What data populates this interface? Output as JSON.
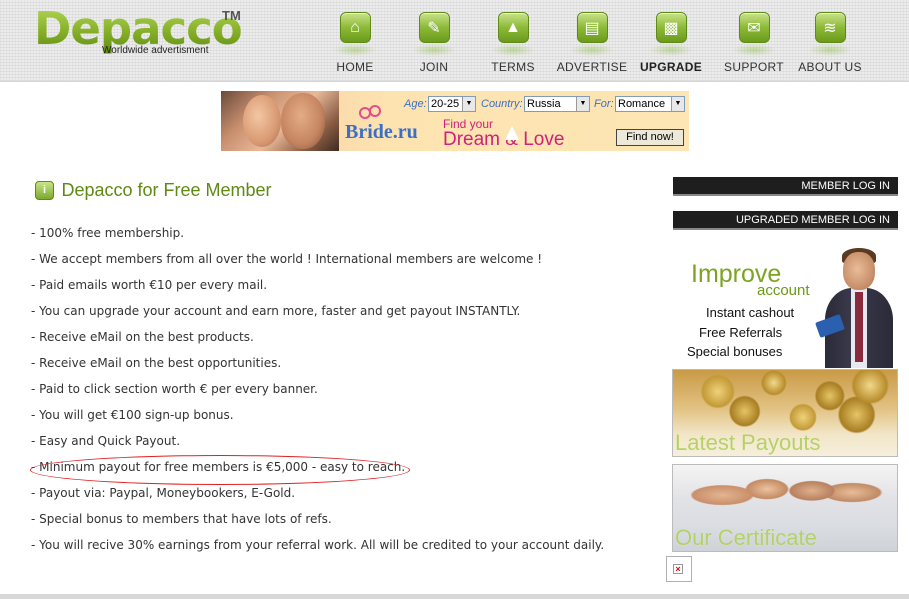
{
  "header": {
    "logo_text": "Depacco",
    "logo_tm": "TM",
    "logo_tagline": "Worldwide advertisment",
    "nav": [
      {
        "label": "HOME",
        "icon": "home-icon"
      },
      {
        "label": "JOIN",
        "icon": "pencil-icon"
      },
      {
        "label": "TERMS",
        "icon": "terms-icon"
      },
      {
        "label": "ADVERTISE",
        "icon": "cart-icon"
      },
      {
        "label": "UPGRADE",
        "icon": "upgrade-icon"
      },
      {
        "label": "SUPPORT",
        "icon": "support-icon"
      },
      {
        "label": "ABOUT US",
        "icon": "rss-icon"
      }
    ]
  },
  "banner": {
    "age_label": "Age:",
    "age_value": "20-25",
    "country_label": "Country:",
    "country_value": "Russia",
    "for_label": "For:",
    "for_value": "Romance",
    "brand": "Bride.ru",
    "find_your": "Find your",
    "dream_love": "Dream & Love",
    "find_button": "Find now!"
  },
  "main": {
    "title": "Depacco for Free Member",
    "benefits": [
      "- 100% free membership.",
      "- We accept members from all over the world ! International members are welcome !",
      "- Paid emails worth €10 per every mail.",
      "- You can upgrade your account and earn more, faster and get payout INSTANTLY.",
      "- Receive eMail on the best products.",
      "- Receive eMail on the best opportunities.",
      "- Paid to click section worth € per every banner.",
      "- You will get €100 sign-up bonus.",
      "- Easy and Quick Payout.",
      "- Minimum payout for free members is €5,000 - easy to reach.",
      "- Payout via: Paypal, Moneybookers, E-Gold.",
      "- Special bonus to members that have lots of refs.",
      "- You will recive 30% earnings from your referral work. All will be credited to your account daily."
    ]
  },
  "sidebar": {
    "member_login": "MEMBER LOG IN",
    "upgraded_login": "UPGRADED MEMBER LOG IN",
    "improve_title": "Improve",
    "improve_sub": "account",
    "improve_lines": [
      "Instant cashout",
      "Free Referrals",
      "Special bonuses"
    ],
    "latest_payouts": "Latest Payouts",
    "our_certificate": "Our Certificate"
  },
  "colors": {
    "brand_green": "#7ca422",
    "title_green": "#5e8a14",
    "sidebar_button": "#1e1e1e",
    "highlight_red": "#dd2222"
  }
}
